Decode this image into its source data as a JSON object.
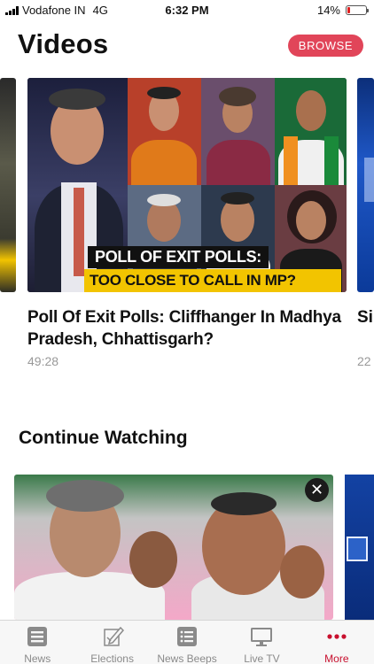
{
  "status_bar": {
    "carrier": "Vodafone IN",
    "network": "4G",
    "time": "6:32 PM",
    "battery_percent": "14%",
    "battery_level": 0.14,
    "battery_color": "#e02020"
  },
  "header": {
    "title": "Videos",
    "browse_label": "BROWSE",
    "accent_color": "#e14559"
  },
  "featured_video": {
    "banner_line1": "POLL OF EXIT POLLS:",
    "banner_line2": "TOO CLOSE TO CALL IN MP?",
    "title": "Poll Of Exit Polls: Cliffhanger In Madhya Pradesh, Chhattisgarh?",
    "duration": "49:28"
  },
  "next_video_peek": {
    "title": "Si So",
    "duration": "22"
  },
  "continue_watching": {
    "title": "Continue Watching",
    "close_icon": "close-icon"
  },
  "tab_bar": {
    "active_color": "#c8102e",
    "tabs": [
      {
        "label": "News",
        "icon": "news-icon"
      },
      {
        "label": "Elections",
        "icon": "elections-icon"
      },
      {
        "label": "News Beeps",
        "icon": "news-beeps-icon"
      },
      {
        "label": "Live TV",
        "icon": "live-tv-icon"
      },
      {
        "label": "More",
        "icon": "more-icon"
      }
    ]
  }
}
